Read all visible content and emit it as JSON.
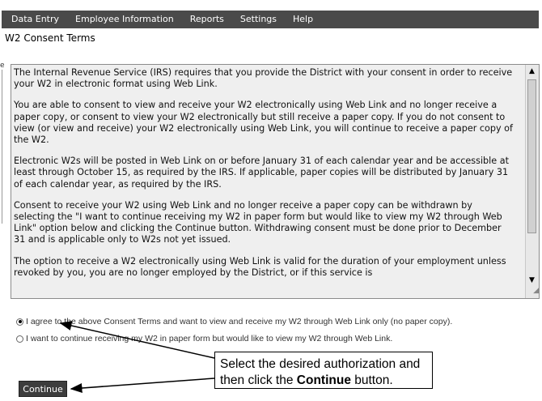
{
  "menu": {
    "items": [
      "Data Entry",
      "Employee Information",
      "Reports",
      "Settings",
      "Help"
    ]
  },
  "page": {
    "title": "W2 Consent Terms"
  },
  "terms": {
    "paragraphs": [
      "The Internal Revenue Service (IRS) requires that you provide the District with your consent in order to receive your W2 in electronic format using Web Link.",
      "You are able to consent to view and receive your W2 electronically using Web Link and no longer receive a paper copy, or consent to view your W2 electronically but still receive a paper copy.  If you do not consent to view (or view and receive) your W2 electronically using Web Link, you will continue to receive a paper copy of the W2.",
      "Electronic W2s will be posted in Web Link on or before January 31 of each calendar year and be accessible at least through October 15, as required by the IRS.  If applicable, paper copies will be distributed by January 31 of each calendar year, as required by the IRS.",
      "Consent to receive your W2 using Web Link and no longer receive a paper copy can be withdrawn by selecting the \"I want to continue receiving my W2 in paper form but would like to view my W2 through Web Link\" option below and clicking the Continue button.  Withdrawing consent must be done prior to December 31 and is applicable only to W2s not yet issued.",
      "The option to receive a W2 electronically using Web Link is valid for the duration of your employment unless revoked by you, you are no longer employed by the District, or if this service is"
    ]
  },
  "options": {
    "agree": "I agree to the above Consent Terms and want to view and receive my W2 through Web Link only (no paper copy).",
    "paper": "I want to continue receiving my W2 in paper form but would like to view my W2 through Web Link.",
    "selected": "agree"
  },
  "callout": {
    "line1": "Select the desired authorization and",
    "line2_prefix": "then click the ",
    "line2_bold": "Continue",
    "line2_suffix": " button."
  },
  "buttons": {
    "continue": "Continue"
  },
  "side_mark": "e"
}
